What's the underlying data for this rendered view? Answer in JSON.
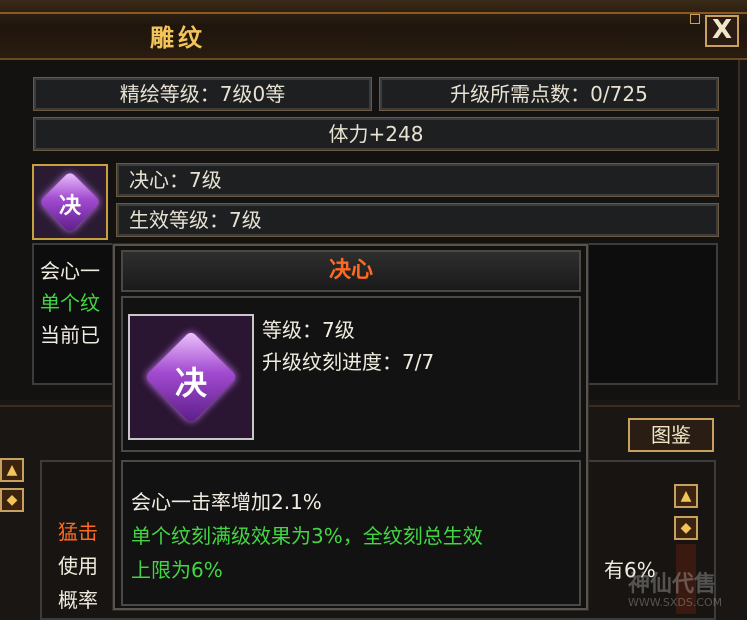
{
  "window": {
    "title": "雕纹",
    "close_label": "X"
  },
  "stats": {
    "refine_level": "精绘等级：7级0等",
    "upgrade_points": "升级所需点数：0/725",
    "bonus": "体力+248"
  },
  "glyph": {
    "icon_char": "决",
    "name_field": "决心：7级",
    "effect_level_field": "生效等级：7级"
  },
  "background_desc": {
    "line1": "会心一",
    "line2": "单个纹",
    "line3": "当前已"
  },
  "lower": {
    "atlas_button": "图鉴",
    "rows": [
      "猛击",
      "使用",
      "概率"
    ],
    "right_text": "有6%",
    "scroll_up": "▲",
    "scroll_down": "◆"
  },
  "tooltip": {
    "title": "决心",
    "level": "等级：7级",
    "progress": "升级纹刻进度：7/7",
    "desc_line1": "会心一击率增加2.1%",
    "desc_line2": "单个纹刻满级效果为3%，全纹刻总生效",
    "desc_line3": "上限为6%"
  },
  "watermark": {
    "text": "神仙代售",
    "url": "WWW.SXDS.COM"
  },
  "colors": {
    "title_gold": "#f3c45a",
    "tooltip_title": "#ff6a20",
    "green_text": "#43d643",
    "orange_text": "#ff6a20"
  }
}
